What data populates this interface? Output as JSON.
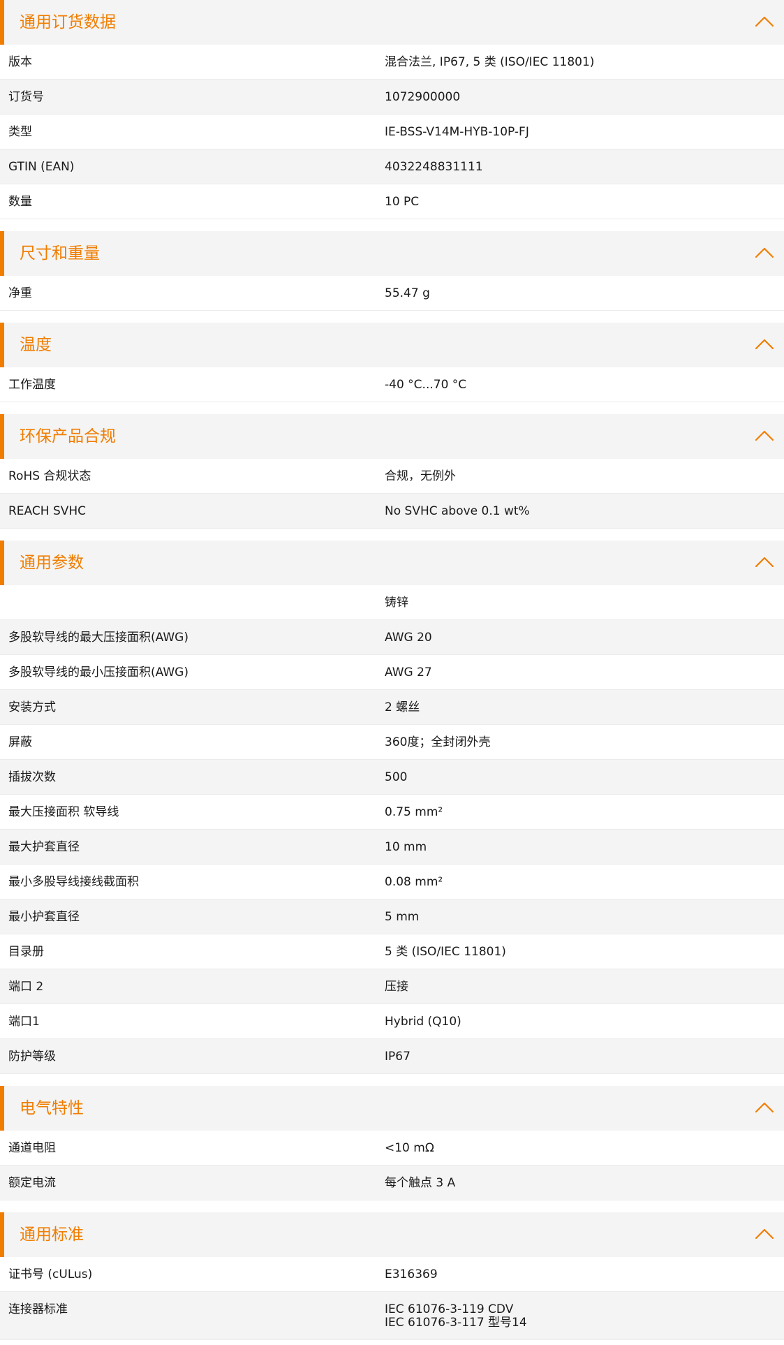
{
  "colors": {
    "accent": "#f07d00",
    "header_bg": "#f4f4f4",
    "row_shaded_bg": "#f4f4f4",
    "text": "#1a1a1a"
  },
  "icons": {
    "collapse": "chevron-up-icon"
  },
  "sections": [
    {
      "id": "general-ordering",
      "title": "通用订货数据",
      "rows": [
        {
          "label": "版本",
          "value": "混合法兰, IP67, 5 类 (ISO/IEC 11801)"
        },
        {
          "label": "订货号",
          "value": "1072900000"
        },
        {
          "label": "类型",
          "value": "IE-BSS-V14M-HYB-10P-FJ"
        },
        {
          "label": "GTIN (EAN)",
          "value": "4032248831111"
        },
        {
          "label": "数量",
          "value": "10  PC"
        }
      ]
    },
    {
      "id": "dimensions-weight",
      "title": "尺寸和重量",
      "rows": [
        {
          "label": "净重",
          "value": "55.47  g"
        }
      ]
    },
    {
      "id": "temperature",
      "title": "温度",
      "rows": [
        {
          "label": "工作温度",
          "value": "-40 °C...70 °C"
        }
      ]
    },
    {
      "id": "environmental-compliance",
      "title": "环保产品合规",
      "rows": [
        {
          "label": "RoHS 合规状态",
          "value": "合规，无例外"
        },
        {
          "label": "REACH SVHC",
          "value": "No SVHC above 0.1 wt%"
        }
      ]
    },
    {
      "id": "general-parameters",
      "title": "通用参数",
      "rows": [
        {
          "label": "",
          "value": "铸锌"
        },
        {
          "label": "多股软导线的最大压接面积(AWG)",
          "value": "AWG 20"
        },
        {
          "label": "多股软导线的最小压接面积(AWG)",
          "value": "AWG 27"
        },
        {
          "label": "安装方式",
          "value": "2 螺丝"
        },
        {
          "label": "屏蔽",
          "value": "360度；全封闭外壳"
        },
        {
          "label": "插拔次数",
          "value": "500"
        },
        {
          "label": "最大压接面积 软导线",
          "value": "0.75  mm²"
        },
        {
          "label": "最大护套直径",
          "value": "10  mm"
        },
        {
          "label": "最小多股导线接线截面积",
          "value": "0.08  mm²"
        },
        {
          "label": "最小护套直径",
          "value": "5  mm"
        },
        {
          "label": "目录册",
          "value": "5 类 (ISO/IEC 11801)"
        },
        {
          "label": "端口 2",
          "value": "压接"
        },
        {
          "label": "端口1",
          "value": "Hybrid (Q10)"
        },
        {
          "label": "防护等级",
          "value": "IP67"
        }
      ]
    },
    {
      "id": "electrical-characteristics",
      "title": "电气特性",
      "rows": [
        {
          "label": "通道电阻",
          "value": "<10 mΩ"
        },
        {
          "label": "额定电流",
          "value": "每个触点 3 A"
        }
      ]
    },
    {
      "id": "general-standards",
      "title": "通用标准",
      "rows": [
        {
          "label": "证书号 (cULus)",
          "value": "E316369"
        },
        {
          "label": "连接器标准",
          "value": "IEC 61076-3-119 CDV\nIEC 61076-3-117 型号14"
        }
      ]
    }
  ]
}
